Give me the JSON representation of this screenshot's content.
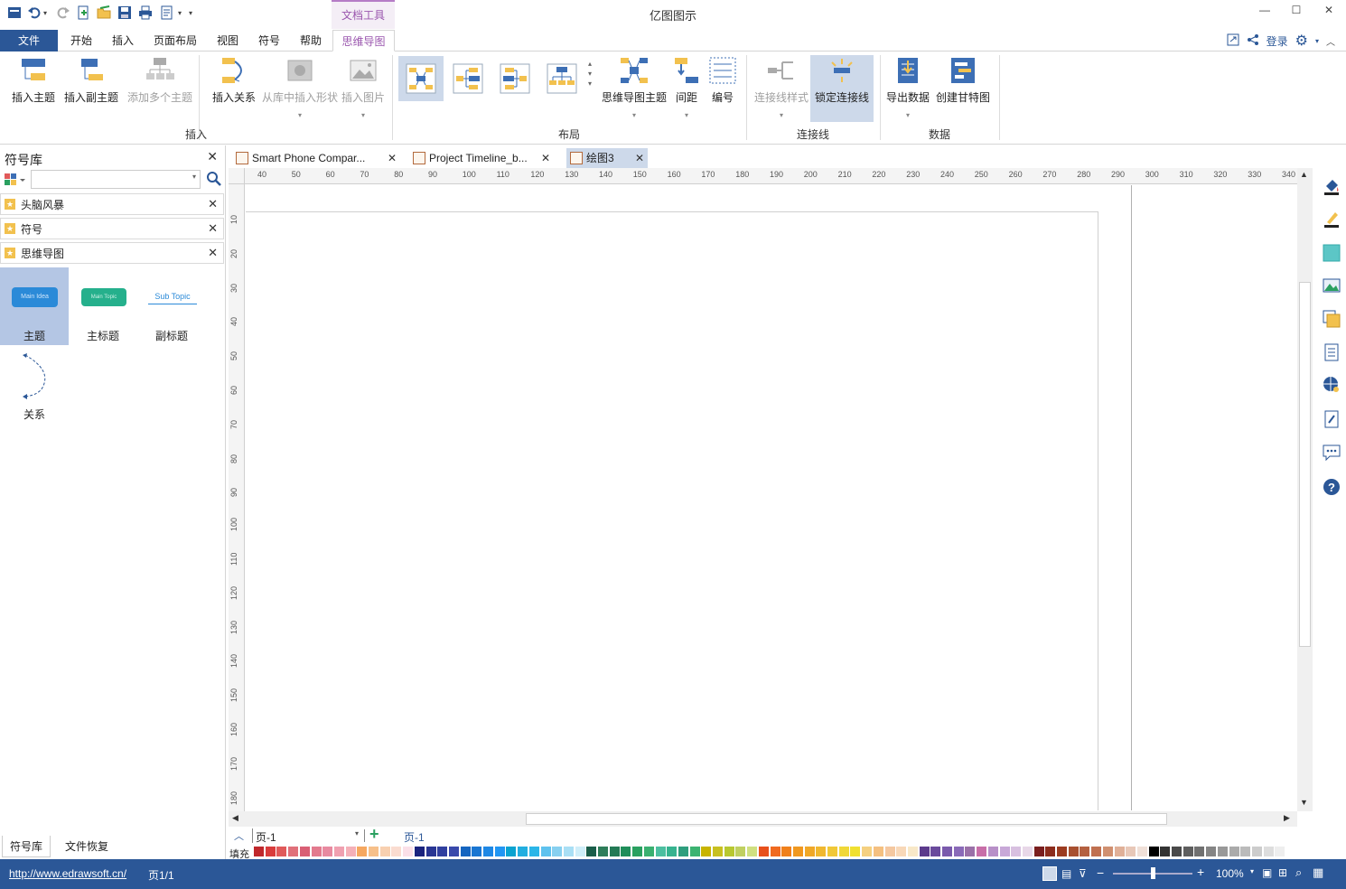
{
  "app": {
    "title": "亿图图示",
    "context_tab": "文档工具"
  },
  "menu": {
    "file": "文件",
    "tabs": [
      "开始",
      "插入",
      "页面布局",
      "视图",
      "符号",
      "帮助",
      "思维导图"
    ],
    "login": "登录"
  },
  "ribbon": {
    "insert": {
      "label": "插入",
      "buttons": [
        "插入主题",
        "插入副主题",
        "添加多个主题",
        "插入关系",
        "从库中插入形状",
        "插入图片"
      ]
    },
    "layout": {
      "label": "布局",
      "buttons": [
        "思维导图主题",
        "间距",
        "编号"
      ]
    },
    "connector": {
      "label": "连接线",
      "buttons": [
        "连接线样式",
        "锁定连接线"
      ]
    },
    "data": {
      "label": "数据",
      "buttons": [
        "导出数据",
        "创建甘特图"
      ]
    }
  },
  "library": {
    "title": "符号库",
    "categories": [
      "头脑风暴",
      "符号",
      "思维导图"
    ],
    "shapes": [
      {
        "label": "主题",
        "preview": "Main Idea"
      },
      {
        "label": "主标题",
        "preview": "Main Topic"
      },
      {
        "label": "副标题",
        "preview": "Sub Topic"
      },
      {
        "label": "关系"
      }
    ],
    "bottom_tabs": [
      "符号库",
      "文件恢复"
    ]
  },
  "doc_tabs": [
    "Smart Phone Compar...",
    "Project Timeline_b...",
    "绘图3"
  ],
  "ruler": {
    "h_ticks": [
      40,
      50,
      60,
      70,
      80,
      90,
      100,
      110,
      120,
      130,
      140,
      150,
      160,
      170,
      180,
      190,
      200,
      210,
      220,
      230,
      240,
      250,
      260,
      270,
      280,
      290,
      300,
      310,
      320,
      330,
      340
    ],
    "v_ticks": [
      10,
      20,
      30,
      40,
      50,
      60,
      70,
      80,
      90,
      100,
      110,
      120,
      130,
      140,
      150,
      160,
      170,
      180
    ]
  },
  "pagebar": {
    "page_select": "页-1",
    "page_tab": "页-1"
  },
  "palette": {
    "label": "填充",
    "colors": [
      "#c0282c",
      "#d93c3c",
      "#e05a5a",
      "#e0707a",
      "#d95f75",
      "#e37a8e",
      "#e88aa0",
      "#f0a0b0",
      "#f5b0b8",
      "#f6a860",
      "#f7c08a",
      "#f8d0b0",
      "#fadcd0",
      "#fbe0e8",
      "#1a237e",
      "#283593",
      "#303f9f",
      "#3949ab",
      "#1565c0",
      "#1976d2",
      "#1e88e5",
      "#2196f3",
      "#0aa3d0",
      "#22aee0",
      "#2bb6e8",
      "#5ec2ee",
      "#87d0f0",
      "#a9dff5",
      "#cfeef9",
      "#1b5e4a",
      "#2e7d5a",
      "#237a55",
      "#1f8e5a",
      "#2aa060",
      "#3ab070",
      "#4cbfa0",
      "#36b38f",
      "#2e9e7e",
      "#3cb371",
      "#c8b400",
      "#c8c020",
      "#b8c830",
      "#c0d060",
      "#d0e080",
      "#e8501c",
      "#f06a20",
      "#f0801c",
      "#f09820",
      "#f0a828",
      "#f0b830",
      "#f0c838",
      "#f0d838",
      "#f0e030",
      "#f5d080",
      "#f5c080",
      "#f5c8a0",
      "#f8d8b8",
      "#f8e8c8",
      "#5c3b8c",
      "#6a4a9c",
      "#7a5aac",
      "#8a6ab8",
      "#9a70a8",
      "#c86ea8",
      "#b890c8",
      "#c8a8d8",
      "#d8c0e0",
      "#e8d8e8",
      "#7a1e1e",
      "#8c2c1c",
      "#9c3c20",
      "#a85030",
      "#b46040",
      "#c07050",
      "#d09070",
      "#e0b098",
      "#e8c8b8",
      "#f0e0d8",
      "#000000",
      "#333333",
      "#4a4a4a",
      "#5e5e5e",
      "#707070",
      "#858585",
      "#999999",
      "#aaaaaa",
      "#bbbbbb",
      "#cccccc",
      "#dddddd",
      "#eeeeee"
    ]
  },
  "status": {
    "url": "http://www.edrawsoft.cn/",
    "page": "页1/1",
    "zoom": "100%",
    "zoom_level": 0.5
  }
}
